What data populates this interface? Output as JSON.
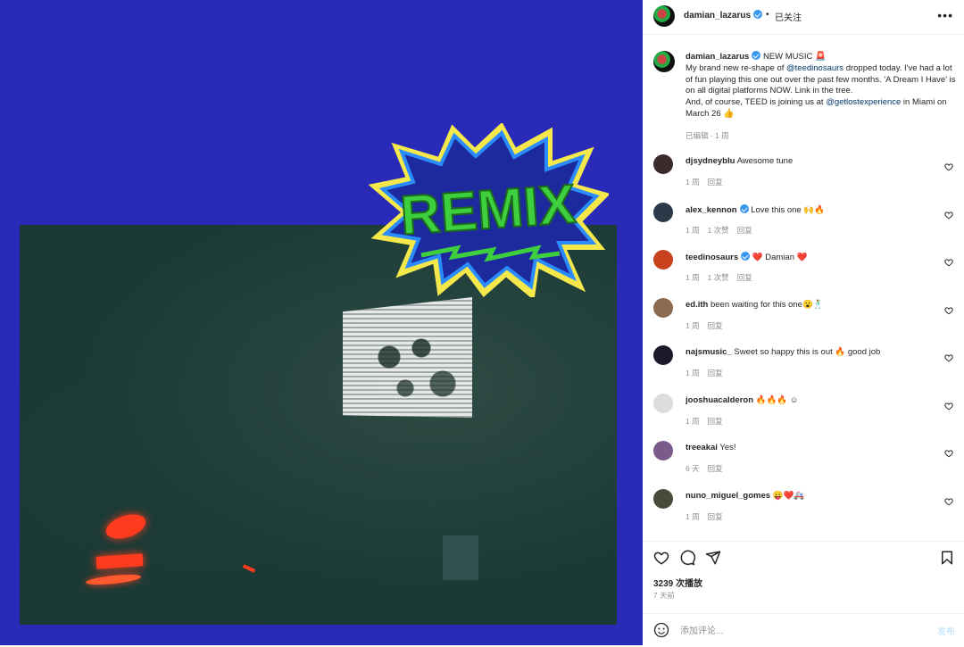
{
  "post": {
    "author": "damian_lazarus",
    "follow_state": "已关注",
    "header_separator": "•",
    "more_label": "•••"
  },
  "caption": {
    "username": "damian_lazarus",
    "headline": "NEW MUSIC",
    "headline_emoji": "🚨",
    "text_1": "My brand new re-shape of ",
    "mention_1": "@teedinosaurs",
    "text_2": " dropped today. I've had a lot of fun playing this one out over the past few months. 'A Dream I Have' is on all digital platforms NOW. Link in the tree.",
    "text_3": "And, of course, TEED is joining us at ",
    "mention_2": "@getlostexperience",
    "text_4": " in Miami on March 26 ",
    "text_4_emoji": "👍",
    "meta": "已编辑 · 1 周"
  },
  "badge_text": "REMIX",
  "comments": [
    {
      "username": "djsydneyblu",
      "verified": false,
      "text": "Awesome tune",
      "time": "1 周",
      "likes": "",
      "reply": "回复",
      "avatar_color": "#3a2a2a"
    },
    {
      "username": "alex_kennon",
      "verified": true,
      "text": "Love this one 🙌🔥",
      "time": "1 周",
      "likes": "1 次赞",
      "reply": "回复",
      "avatar_color": "#2b3a48"
    },
    {
      "username": "teedinosaurs",
      "verified": true,
      "text": "❤️ Damian ❤️",
      "time": "1 周",
      "likes": "1 次赞",
      "reply": "回复",
      "avatar_color": "#c8421e"
    },
    {
      "username": "ed.ith",
      "verified": false,
      "text": "been waiting for this one😮🕺",
      "time": "1 周",
      "likes": "",
      "reply": "回复",
      "avatar_color": "#8a6a50"
    },
    {
      "username": "najsmusic_",
      "verified": false,
      "text": "Sweet so happy this is out 🔥 good job",
      "time": "1 周",
      "likes": "",
      "reply": "回复",
      "avatar_color": "#1a1a2a"
    },
    {
      "username": "jooshuacalderon",
      "verified": false,
      "text": "🔥🔥🔥 ☺",
      "time": "1 周",
      "likes": "",
      "reply": "回复",
      "avatar_color": "#dcdcdc"
    },
    {
      "username": "treeakai",
      "verified": false,
      "text": "Yes!",
      "time": "6 天",
      "likes": "",
      "reply": "回复",
      "avatar_color": "#7a5a8a"
    },
    {
      "username": "nuno_miguel_gomes",
      "verified": false,
      "text": "😛❤️🚑",
      "time": "1 周",
      "likes": "",
      "reply": "回复",
      "avatar_color": "#4a4a3a"
    }
  ],
  "stats": {
    "plays": "3239 次播放",
    "posted": "7 天前"
  },
  "composer": {
    "placeholder": "添加评论...",
    "post_label": "发布"
  },
  "colors": {
    "media_bg": "#2a2ab8",
    "badge_green": "#3ecf3e",
    "badge_blue": "#2a8cff",
    "badge_yellow": "#f5e84a",
    "link": "#00376b",
    "verified": "#3897f0"
  }
}
